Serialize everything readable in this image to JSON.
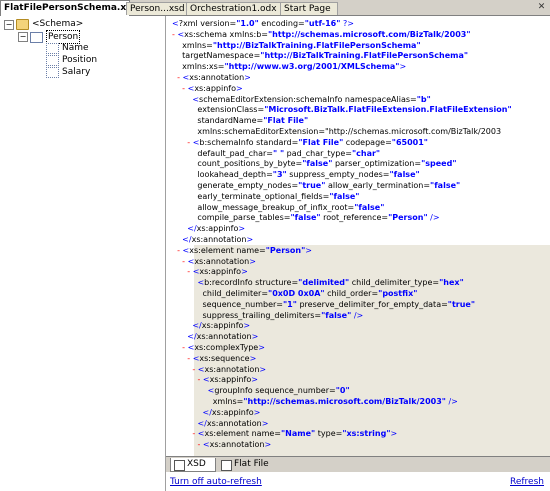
{
  "tabs": [
    {
      "label": "FlatFilePersonSchema.xsd*",
      "active": true
    },
    {
      "label": "Person...xsd",
      "active": false
    },
    {
      "label": "Orchestration1.odx",
      "active": false
    },
    {
      "label": "Start Page",
      "active": false
    }
  ],
  "tree": {
    "root": "<Schema>",
    "record": "Person",
    "fields": [
      "Name",
      "Position",
      "Salary"
    ]
  },
  "xml_lines": [
    "<?xml version=\"1.0\" encoding=\"utf-16\" ?>",
    "- <xs:schema xmlns:b=\"http://schemas.microsoft.com/BizTalk/2003\"",
    "    xmlns=\"http://BizTalkTraining.FlatFilePersonSchema\"",
    "    targetNamespace=\"http://BizTalkTraining.FlatFilePersonSchema\"",
    "    xmlns:xs=\"http://www.w3.org/2001/XMLSchema\">",
    "  - <xs:annotation>",
    "    - <xs:appinfo>",
    "        <schemaEditorExtension:schemaInfo namespaceAlias=\"b\"",
    "          extensionClass=\"Microsoft.BizTalk.FlatFileExtension.FlatFileExtension\"",
    "          standardName=\"Flat File\"",
    "          xmlns:schemaEditorExtension=\"http://schemas.microsoft.com/BizTalk/2003",
    "      - <b:schemaInfo standard=\"Flat File\" codepage=\"65001\"",
    "          default_pad_char=\" \" pad_char_type=\"char\"",
    "          count_positions_by_byte=\"false\" parser_optimization=\"speed\"",
    "          lookahead_depth=\"3\" suppress_empty_nodes=\"false\"",
    "          generate_empty_nodes=\"true\" allow_early_termination=\"false\"",
    "          early_terminate_optional_fields=\"false\"",
    "          allow_message_breakup_of_infix_root=\"false\"",
    "          compile_parse_tables=\"false\" root_reference=\"Person\" />",
    "      </xs:appinfo>",
    "    </xs:annotation>",
    "  - <xs:element name=\"Person\">",
    "    - <xs:annotation>",
    "      - <xs:appinfo>",
    "          <b:recordInfo structure=\"delimited\" child_delimiter_type=\"hex\"",
    "            child_delimiter=\"0x0D 0x0A\" child_order=\"postfix\"",
    "            sequence_number=\"1\" preserve_delimiter_for_empty_data=\"true\"",
    "            suppress_trailing_delimiters=\"false\" />",
    "        </xs:appinfo>",
    "      </xs:annotation>",
    "    - <xs:complexType>",
    "      - <xs:sequence>",
    "        - <xs:annotation>",
    "          - <xs:appinfo>",
    "              <groupInfo sequence_number=\"0\"",
    "                xmlns=\"http://schemas.microsoft.com/BizTalk/2003\" />",
    "            </xs:appinfo>",
    "          </xs:annotation>",
    "        - <xs:element name=\"Name\" type=\"xs:string\">",
    "          - <xs:annotation>"
  ],
  "bottom_tabs": [
    {
      "label": "XSD",
      "active": true
    },
    {
      "label": "Flat File",
      "active": false
    }
  ],
  "status": {
    "left_link": "Turn off auto-refresh",
    "right_link": "Refresh"
  }
}
